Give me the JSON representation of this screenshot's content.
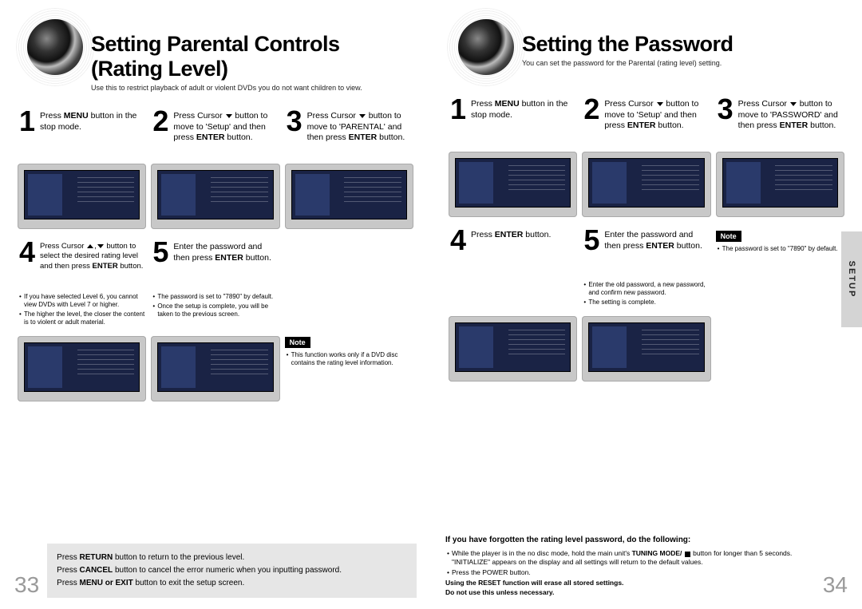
{
  "left": {
    "title": "Setting Parental Controls (Rating Level)",
    "subtitle": "Use this to restrict playback of adult or violent DVDs you do not want children to view.",
    "steps": {
      "s1": "Press <b>MENU</b> button in the stop mode.",
      "s2": "Press Cursor <span class='cursor-icon cursor-down'></span> button to move to 'Setup' and then press <b>ENTER</b> button.",
      "s3": "Press Cursor <span class='cursor-icon cursor-down'></span> button to move to 'PARENTAL' and then press <b>ENTER</b> button.",
      "s4": "Press Cursor <span class='cursor-icon cursor-up'></span>,<span class='cursor-icon cursor-down'></span> button to select the desired rating level and then press <b>ENTER</b> button.",
      "s5": "Enter the password and then press <b>ENTER</b> button."
    },
    "bullets4": [
      "If you have selected Level 6, you cannot view DVDs with Level 7 or higher.",
      "The higher the level, the closer the content is to violent or adult material."
    ],
    "bullets5": [
      "The password is set to \"7890\" by default.",
      "Once the setup is complete, you will be taken to the previous screen."
    ],
    "noteLabel": "Note",
    "noteBullets": [
      "This function works only if a DVD disc contains the rating level information."
    ],
    "bottom": {
      "line1": "Press <b>RETURN</b> button to return to the previous level.",
      "line2": "Press <b>CANCEL</b> button to cancel the error numeric when you inputting password.",
      "line3": "Press <b>MENU or EXIT</b> button to exit the setup screen."
    },
    "pageNum": "33"
  },
  "right": {
    "title": "Setting the Password",
    "subtitle": "You can set the password for the Parental (rating level) setting.",
    "steps": {
      "s1": "Press <b>MENU</b> button in the stop mode.",
      "s2": "Press Cursor <span class='cursor-icon cursor-down'></span> button to move to 'Setup' and then press <b>ENTER</b> button.",
      "s3": "Press Cursor <span class='cursor-icon cursor-down'></span> button to move to 'PASSWORD' and then press <b>ENTER</b> button.",
      "s4": "Press <b>ENTER</b> button.",
      "s5": "Enter the password and then press <b>ENTER</b> button."
    },
    "bullets5": [
      "Enter the old password, a new password, and confirm new password.",
      "The setting is complete."
    ],
    "noteLabel": "Note",
    "noteBullets": [
      "The password is set to \"7890\" by default."
    ],
    "bottom": {
      "heading": "If you have forgotten the rating level password, do the following:",
      "b1": "While the player is in the no disc mode, hold the main unit's <b>TUNING MODE/ <span class='stopsq'></span></b> button for longer than 5 seconds. \"INITIALIZE\" appears on the display and all settings will return to the default values.",
      "b2": "Press the POWER button.",
      "b3": "<b>Using the RESET function will erase all stored settings.<br>Do not use this unless necessary.</b>"
    },
    "pageNum": "34",
    "sideTab": "SETUP"
  }
}
